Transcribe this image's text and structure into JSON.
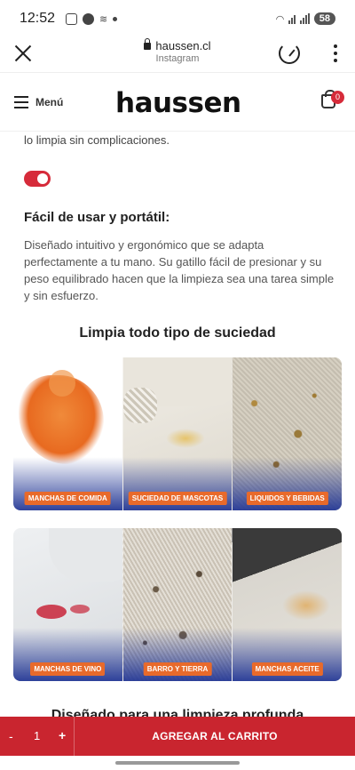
{
  "status": {
    "time": "12:52",
    "battery": "58"
  },
  "browser": {
    "url": "haussen.cl",
    "source": "Instagram"
  },
  "header": {
    "menu_label": "Menú",
    "logo": "haussen",
    "cart_count": "0"
  },
  "content": {
    "intro": "lo limpia sin complicaciones.",
    "feature_title": "Fácil de usar y portátil:",
    "feature_body": "Diseñado intuitivo y  ergonómico que se adapta perfectamente a tu mano. Su gatillo fácil de presionar y su peso equilibrado hacen que la limpieza sea una tarea simple y sin esfuerzo.",
    "section_title": "Limpia todo tipo de suciedad",
    "tiles": [
      "MANCHAS DE COMIDA",
      "SUCIEDAD DE MASCOTAS",
      "LIQUIDOS Y BEBIDAS",
      "MANCHAS DE VINO",
      "BARRO Y TIERRA",
      "MANCHAS ACEITE"
    ],
    "next_title": "Diseñado para una limpieza profunda"
  },
  "cart_bar": {
    "minus": "-",
    "qty": "1",
    "plus": "+",
    "add_label": "AGREGAR AL CARRITO"
  },
  "colors": {
    "accent": "#d62b3a",
    "tag": "#e86a2b"
  }
}
